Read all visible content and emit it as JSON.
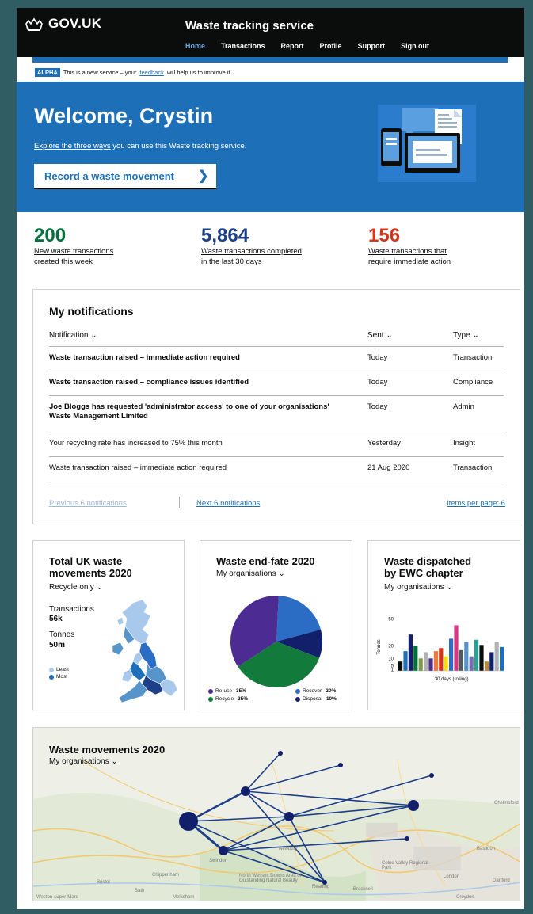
{
  "header": {
    "logo_text": "GOV.UK",
    "service_name": "Waste tracking service",
    "nav": [
      "Home",
      "Transactions",
      "Report",
      "Profile",
      "Support",
      "Sign out"
    ]
  },
  "phase_banner": {
    "tag": "ALPHA",
    "text_before": "This is a new service – your",
    "link": "feedback",
    "text_after": "will help us to improve it."
  },
  "hero": {
    "title": "Welcome, Crystin",
    "sub_link": "Explore the three ways",
    "sub_text": " you can use this Waste tracking service.",
    "cta": "Record a waste movement",
    "cta_icon": "chevron-right-icon"
  },
  "stats": [
    {
      "value": "200",
      "label_line1": "New waste transactions",
      "label_line2": "created this week",
      "color": "#00703c"
    },
    {
      "value": "5,864",
      "label_line1": "Waste transactions completed",
      "label_line2": "in the last 30 days",
      "color": "#1d3f8a"
    },
    {
      "value": "156",
      "label_line1": "Waste transactions that",
      "label_line2": "require immediate action",
      "color": "#d4351c"
    }
  ],
  "notifications": {
    "title": "My notifications",
    "headers": {
      "notification": "Notification ⌄",
      "sent": "Sent ⌄",
      "type": "Type ⌄"
    },
    "rows": [
      {
        "text": "Waste transaction raised – immediate action required",
        "sent": "Today",
        "type": "Transaction",
        "bold": true
      },
      {
        "text": "Waste transaction raised – compliance issues identified",
        "sent": "Today",
        "type": "Compliance",
        "bold": true
      },
      {
        "text": "Joe Bloggs has requested 'administrator access' to one of your organisations' Waste Management Limited",
        "sent": "Today",
        "type": "Admin",
        "bold": true
      },
      {
        "text": "Your recycling rate has increased to 75% this month",
        "sent": "Yesterday",
        "type": "Insight",
        "bold": false
      },
      {
        "text": "Waste transaction raised – immediate action required",
        "sent": "21 Aug 2020",
        "type": "Transaction",
        "bold": false
      }
    ],
    "prev": "Previous 6 notifications",
    "next": "Next 6 notifications",
    "items_per_page": "Items per page: 6"
  },
  "uk_card": {
    "title_line1": "Total UK waste",
    "title_line2": "movements 2020",
    "filter": "Recycle only ⌄",
    "transactions_label": "Transactions",
    "transactions_value": "56k",
    "tonnes_label": "Tonnes",
    "tonnes_value": "50m",
    "legend": [
      "Least",
      "Most"
    ],
    "colors": {
      "least": "#a9c9ec",
      "most": "#1d70b8"
    }
  },
  "fate_card": {
    "title": "Waste end-fate 2020",
    "filter": "My organisations ⌄",
    "legend_left": [
      "Re-use",
      "Recycle"
    ],
    "legend_left_values": [
      "35%",
      "35%"
    ],
    "legend_right": [
      "Recover",
      "Disposal"
    ],
    "legend_right_values": [
      "20%",
      "10%"
    ],
    "chart_data": {
      "type": "pie",
      "slices": [
        {
          "name": "Recover",
          "value": 20,
          "color": "#2b6cc4"
        },
        {
          "name": "Disposal",
          "value": 10,
          "color": "#12206b"
        },
        {
          "name": "Recycle",
          "value": 35,
          "color": "#127a3a"
        },
        {
          "name": "Re-use",
          "value": 35,
          "color": "#4c2c92"
        }
      ]
    }
  },
  "ewc_card": {
    "title_line1": "Waste dispatched",
    "title_line2": "by EWC chapter",
    "filter": "My organisations ⌄",
    "chart_data": {
      "type": "bar",
      "ylabel": "Tonnes",
      "xlabel": "30 days (rolling)",
      "yticks": [
        "1",
        "5",
        "10",
        "20",
        "50"
      ],
      "values": [
        9,
        19,
        35,
        24,
        12,
        18,
        12,
        19,
        22,
        14,
        31,
        44,
        20,
        28,
        14,
        30,
        25,
        9,
        18,
        28,
        23
      ],
      "colors": [
        "#0b0c0c",
        "#1d70b8",
        "#12206b",
        "#00703c",
        "#85994b",
        "#b1b4b6",
        "#4c2c92",
        "#f47738",
        "#d4351c",
        "#ffdd00",
        "#2b6cc4",
        "#d53880",
        "#505a5f",
        "#5694ca",
        "#6f72af",
        "#28a197",
        "#0b0c0c",
        "#b58840",
        "#12206b",
        "#b1b4b6",
        "#1d70b8"
      ],
      "ylim": [
        0,
        55
      ]
    }
  },
  "moves_card": {
    "title": "Waste movements 2020",
    "filter": "My organisations ⌄",
    "places": [
      "Bristol",
      "Bath",
      "Chippenham",
      "Swindon",
      "Reading",
      "Bracknell",
      "London",
      "Croydon",
      "Chelmsford",
      "Colne Valley Regional Park",
      "North Wessex Downs Area of Outstanding Natural Beauty",
      "Basildon",
      "Dartford",
      "Melksham",
      "Weston-super-Mare",
      "Newbury"
    ]
  }
}
